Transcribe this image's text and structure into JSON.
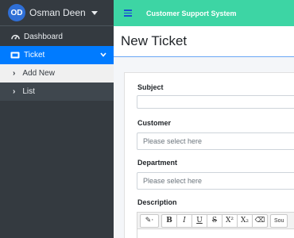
{
  "user": {
    "initials": "OD",
    "name": "Osman Deen"
  },
  "sidebar": {
    "items": [
      {
        "label": "Dashboard",
        "icon": "dashboard-icon"
      },
      {
        "label": "Ticket",
        "icon": "ticket-icon",
        "active": true,
        "expanded": true
      }
    ],
    "submenu": [
      {
        "label": "Add New",
        "icon": "chevron-right-icon"
      },
      {
        "label": "List",
        "icon": "chevron-right-icon"
      }
    ]
  },
  "header": {
    "title": "Customer Support System",
    "menu_icon": "hamburger-icon"
  },
  "page": {
    "title": "New Ticket"
  },
  "form": {
    "subject": {
      "label": "Subject",
      "value": ""
    },
    "customer": {
      "label": "Customer",
      "placeholder": "Please select here"
    },
    "department": {
      "label": "Department",
      "placeholder": "Please select here"
    },
    "description": {
      "label": "Description"
    }
  },
  "editor": {
    "buttons": [
      {
        "label": "✎·",
        "icon": "magic-wand-icon"
      },
      {
        "label": "B",
        "icon": "bold-icon"
      },
      {
        "label": "I",
        "icon": "italic-icon"
      },
      {
        "label": "U",
        "icon": "underline-icon"
      },
      {
        "label": "S",
        "icon": "strikethrough-icon"
      },
      {
        "label": "X²",
        "icon": "superscript-icon"
      },
      {
        "label": "X₂",
        "icon": "subscript-icon"
      },
      {
        "label": "⌫",
        "icon": "eraser-icon"
      }
    ],
    "source_label": "Sou"
  },
  "colors": {
    "sidebar": "#343a40",
    "active": "#007bff",
    "topbar": "#3dd5a4",
    "avatar": "#2f6fd6"
  }
}
